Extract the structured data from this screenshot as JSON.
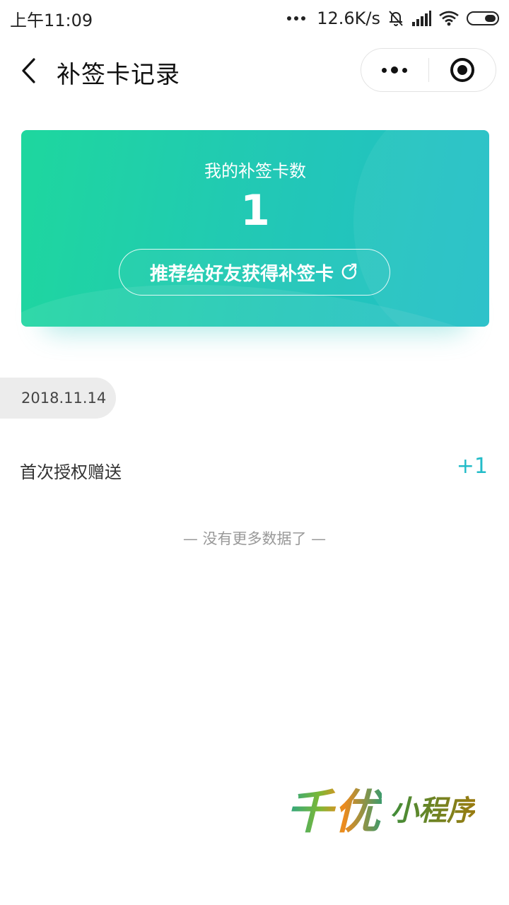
{
  "status_bar": {
    "time": "上午11:09",
    "network_speed": "12.6K/s",
    "icons": [
      "more-dots-icon",
      "bell-muted-icon",
      "signal-icon",
      "wifi-icon",
      "battery-icon"
    ]
  },
  "nav": {
    "title": "补签卡记录",
    "back_icon": "chevron-left-icon",
    "capsule_icons": [
      "more-icon",
      "target-icon"
    ]
  },
  "card": {
    "label": "我的补签卡数",
    "count": "1",
    "recommend_label": "推荐给好友获得补签卡",
    "recommend_icon": "share-icon",
    "colors": {
      "start": "#1ed79e",
      "end": "#23bfc8"
    }
  },
  "records": [
    {
      "date": "2018.11.14",
      "items": [
        {
          "label": "首次授权赠送",
          "amount": "+1"
        }
      ]
    }
  ],
  "footer": {
    "no_more": "— 没有更多数据了 —"
  },
  "watermark": {
    "big": "千优",
    "small": "小程序"
  },
  "colors": {
    "accent": "#23bcc8"
  }
}
